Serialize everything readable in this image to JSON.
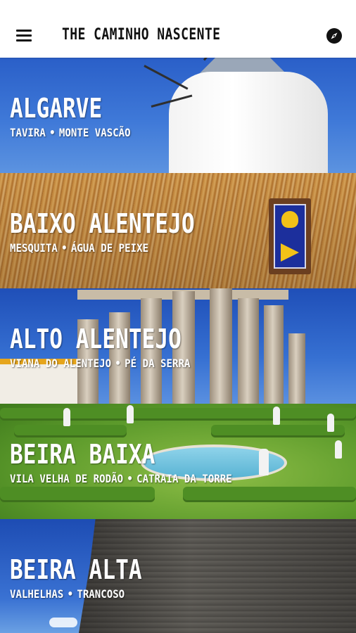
{
  "header": {
    "title": "THE CAMINHO NASCENTE",
    "menu_icon": "hamburger-menu-icon",
    "compass_icon": "compass-icon"
  },
  "sections": [
    {
      "name": "ALGARVE",
      "route": [
        "TAVIRA",
        "MONTE VASCÃO"
      ]
    },
    {
      "name": "BAIXO ALENTEJO",
      "route": [
        "MESQUITA",
        "ÁGUA DE PEIXE"
      ]
    },
    {
      "name": "ALTO ALENTEJO",
      "route": [
        "VIANA DO ALENTEJO",
        "PÉ DA SERRA"
      ]
    },
    {
      "name": "BEIRA BAIXA",
      "route": [
        "VILA VELHA DE RODÃO",
        "CATRAIA DA TORRE"
      ]
    },
    {
      "name": "BEIRA ALTA",
      "route": [
        "VALHELHAS",
        "TRANCOSO"
      ]
    }
  ],
  "separator": "•"
}
